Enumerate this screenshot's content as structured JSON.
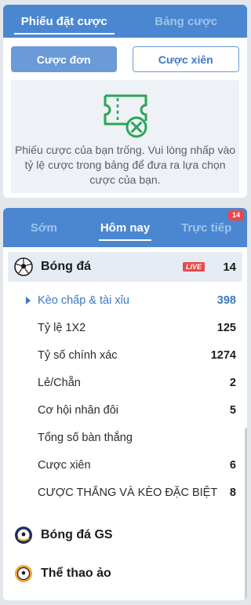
{
  "bet_slip": {
    "tabs": [
      {
        "label": "Phiếu đặt cược",
        "active": true
      },
      {
        "label": "Bảng cược",
        "active": false
      }
    ],
    "buttons": {
      "single": "Cược đơn",
      "parlay": "Cược xiên"
    },
    "empty_icon": "ticket-cancel-icon",
    "empty_message": "Phiếu cược của bạn trống. Vui lòng nhấp vào tỷ lệ cược trong bảng để đưa ra lựa chọn cược của bạn."
  },
  "sports_panel": {
    "tabs": [
      {
        "label": "Sớm",
        "active": false
      },
      {
        "label": "Hôm nay",
        "active": true
      },
      {
        "label": "Trực tiếp",
        "active": false,
        "count": "14"
      }
    ],
    "selected_sport": {
      "icon": "soccer-ball-icon",
      "name": "Bóng đá",
      "live": "LIVE",
      "count": "14"
    },
    "markets": [
      {
        "label": "Kèo chấp & tài xỉu",
        "count": "398",
        "active": true
      },
      {
        "label": "Tỷ lệ 1X2",
        "count": "125"
      },
      {
        "label": "Tỷ số chính xác",
        "count": "1274"
      },
      {
        "label": "Lẻ/Chẵn",
        "count": "2"
      },
      {
        "label": "Cơ hội nhân đôi",
        "count": "5"
      },
      {
        "label": "Tổng số bàn thắng",
        "count": ""
      },
      {
        "label": "Cược xiên",
        "count": "6"
      },
      {
        "label": "CƯỢC THẮNG VÀ KÈO ĐẶC BIỆT",
        "count": "8"
      }
    ],
    "other_sports": [
      {
        "icon": "soccer-gs-icon",
        "name": "Bóng đá GS"
      },
      {
        "icon": "virtual-sports-icon",
        "name": "Thể thao ảo"
      }
    ]
  },
  "colors": {
    "primary": "#4a87d0",
    "accent_text": "#3a78c2",
    "live_red": "#ea4a4a",
    "icon_green": "#2aa55a"
  }
}
